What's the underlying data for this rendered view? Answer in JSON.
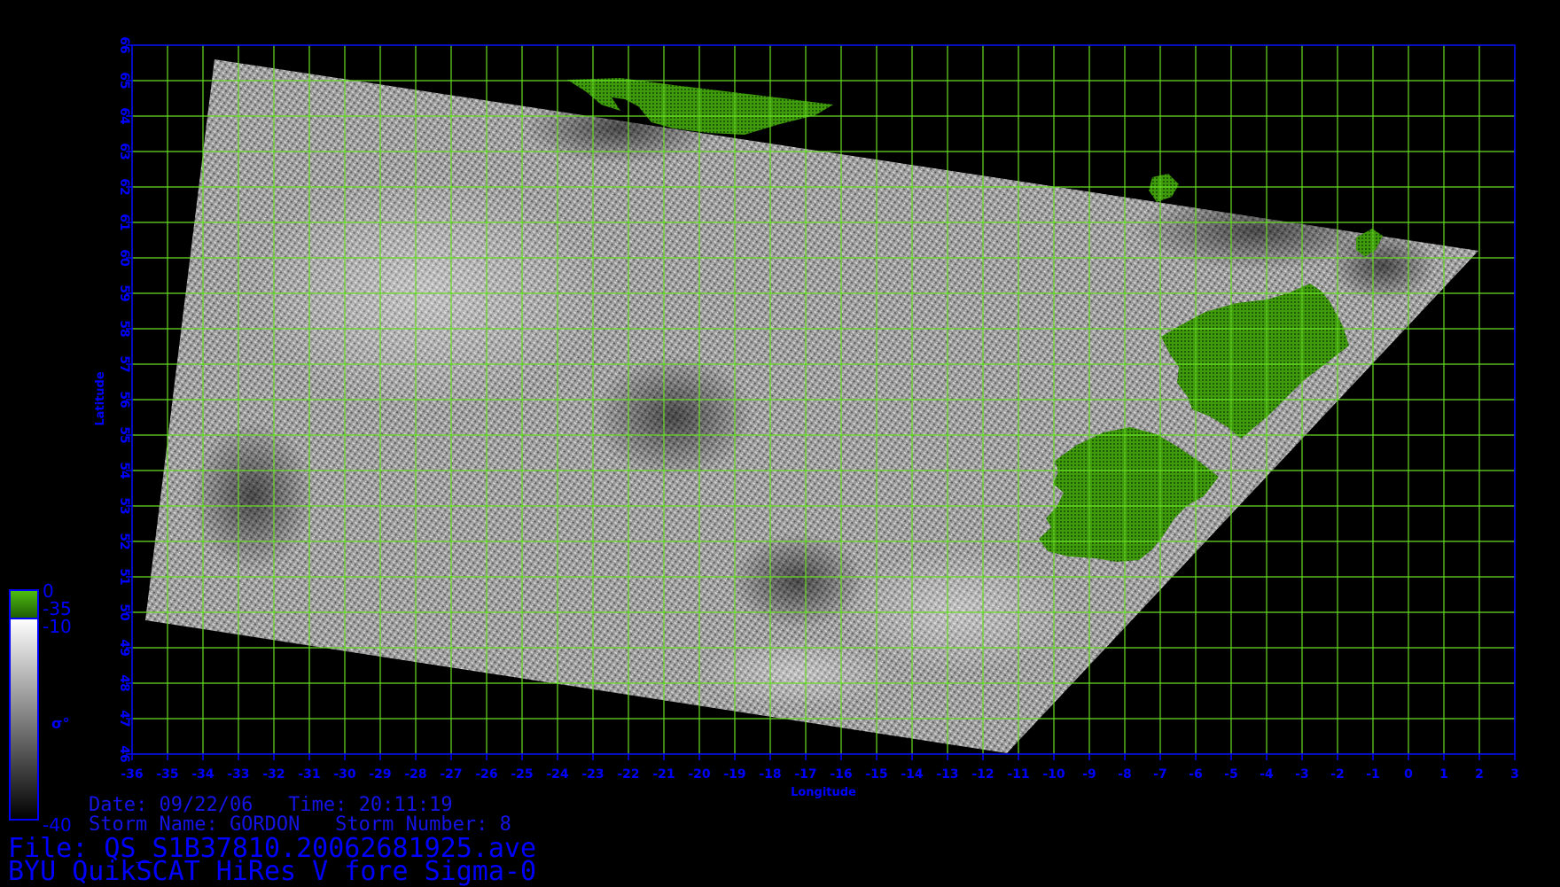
{
  "axes": {
    "xlabel": "Longitude",
    "ylabel": "Latitude",
    "x_ticks": [
      "-36",
      "-35",
      "-34",
      "-33",
      "-32",
      "-31",
      "-30",
      "-29",
      "-28",
      "-27",
      "-26",
      "-25",
      "-24",
      "-23",
      "-22",
      "-21",
      "-20",
      "-19",
      "-18",
      "-17",
      "-16",
      "-15",
      "-14",
      "-13",
      "-12",
      "-11",
      "-10",
      "-9",
      "-8",
      "-7",
      "-6",
      "-5",
      "-4",
      "-3",
      "-2",
      "-1",
      "0",
      "1",
      "2",
      "3"
    ],
    "y_ticks": [
      "46",
      "47",
      "48",
      "49",
      "50",
      "51",
      "52",
      "53",
      "54",
      "55",
      "56",
      "57",
      "58",
      "59",
      "60",
      "61",
      "62",
      "63",
      "64",
      "65",
      "66"
    ],
    "x_range": [
      -36,
      3
    ],
    "y_range": [
      46,
      66
    ],
    "grid": true,
    "grid_color": "#66dd22",
    "axis_color": "#0000ff"
  },
  "colorbar": {
    "land_label_top": "0",
    "land_label_bottom": "-35",
    "sigma_label_top": "-10",
    "sigma_label_bottom": "-40",
    "symbol": "σ°",
    "land_color": "#3f9a0c",
    "border_color": "#0000ff"
  },
  "info": {
    "date_time": "Date: 09/22/06   Time: 20:11:19",
    "storm": "Storm Name: GORDON   Storm Number: 8",
    "file": "File: QS_S1B37810.20062681925.ave",
    "product": "BYU QuikSCAT HiRes V fore Sigma-0"
  }
}
